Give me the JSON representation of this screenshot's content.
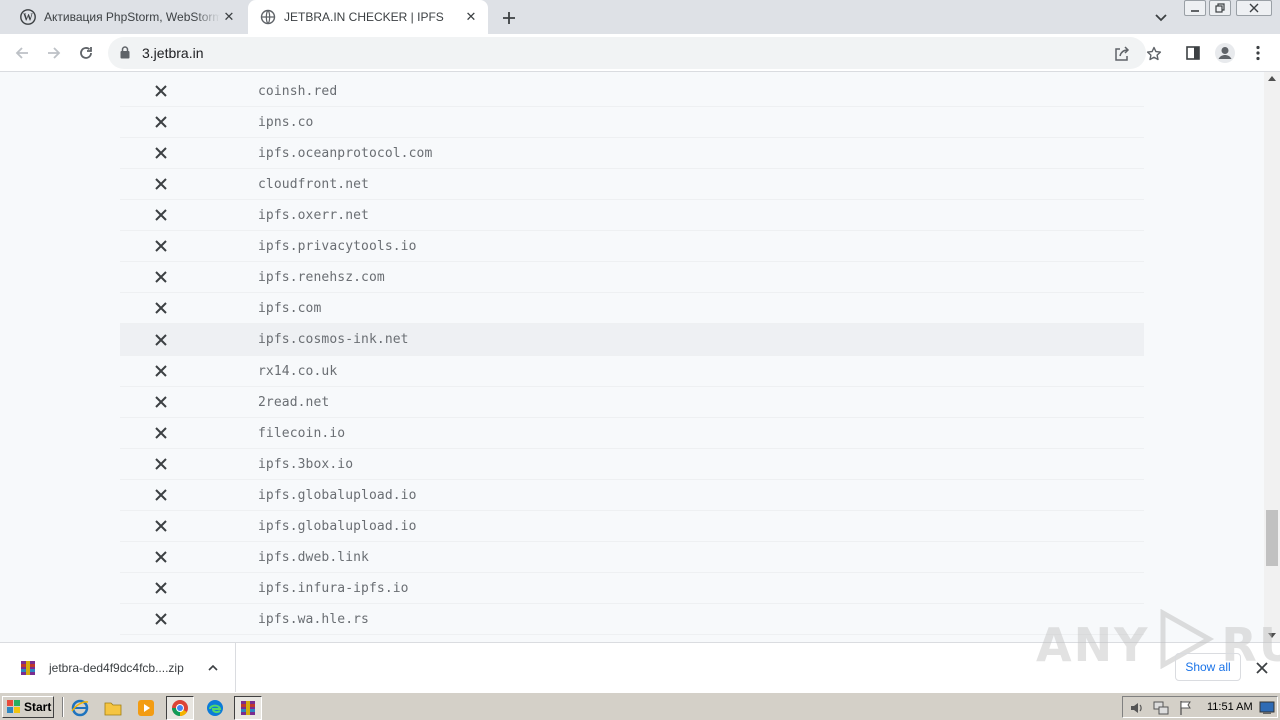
{
  "browser": {
    "tabs": [
      {
        "title": "Активация PhpStorm, WebStorm, IntelliJ IDEA",
        "active": false
      },
      {
        "title": "JETBRA.IN CHECKER | IPFS",
        "active": true
      }
    ],
    "url": "3.jetbra.in"
  },
  "checker": {
    "rows": [
      {
        "domain": "coinsh.red"
      },
      {
        "domain": "ipns.co"
      },
      {
        "domain": "ipfs.oceanprotocol.com"
      },
      {
        "domain": "cloudfront.net"
      },
      {
        "domain": "ipfs.oxerr.net"
      },
      {
        "domain": "ipfs.privacytools.io"
      },
      {
        "domain": "ipfs.renehsz.com"
      },
      {
        "domain": "ipfs.com"
      },
      {
        "domain": "ipfs.cosmos-ink.net"
      },
      {
        "domain": "rx14.co.uk"
      },
      {
        "domain": "2read.net"
      },
      {
        "domain": "filecoin.io"
      },
      {
        "domain": "ipfs.3box.io"
      },
      {
        "domain": "ipfs.globalupload.io"
      },
      {
        "domain": "ipfs.globalupload.io"
      },
      {
        "domain": "ipfs.dweb.link"
      },
      {
        "domain": "ipfs.infura-ipfs.io"
      },
      {
        "domain": "ipfs.wa.hle.rs"
      }
    ],
    "status_icon": "fail-x-icon"
  },
  "downloads": {
    "item_name": "jetbra-ded4f9dc4fcb....zip",
    "show_all": "Show all"
  },
  "watermark": {
    "left": "ANY",
    "right": "RUN"
  },
  "taskbar": {
    "start": "Start",
    "clock": "11:51 AM"
  },
  "colors": {
    "tabstrip": "#dee1e6",
    "content_bg": "#f7f9fb",
    "x_icon": "#3c4043",
    "link_blue": "#1a73e8"
  }
}
